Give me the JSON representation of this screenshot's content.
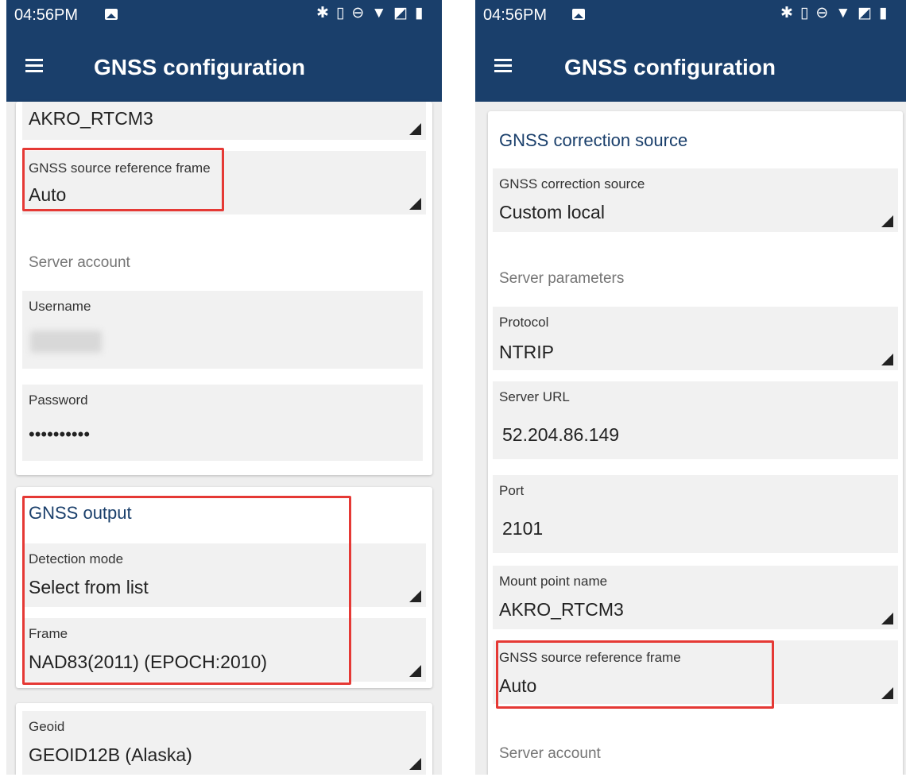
{
  "status_bar": {
    "time": "04:56PM",
    "icons": [
      "image-icon",
      "bluetooth-icon",
      "vibrate-icon",
      "do-not-disturb-icon",
      "wifi-icon",
      "no-sim-icon",
      "battery-icon"
    ]
  },
  "app_bar": {
    "title": "GNSS configuration"
  },
  "left_screen": {
    "mount_point_value": "AKRO_RTCM3",
    "reference_frame": {
      "label": "GNSS source reference frame",
      "value": "Auto"
    },
    "server_account": {
      "label": "Server account",
      "username_label": "Username",
      "password_label": "Password",
      "password_value": "••••••••••"
    },
    "gnss_output": {
      "title": "GNSS output",
      "detection_mode": {
        "label": "Detection mode",
        "value": "Select from list"
      },
      "frame": {
        "label": "Frame",
        "value": "NAD83(2011) (EPOCH:2010)"
      }
    },
    "geoid": {
      "label": "Geoid",
      "value": "GEOID12B (Alaska)"
    }
  },
  "right_screen": {
    "section_title": "GNSS correction source",
    "correction_source": {
      "label": "GNSS correction source",
      "value": "Custom local"
    },
    "server_parameters_label": "Server parameters",
    "protocol": {
      "label": "Protocol",
      "value": "NTRIP"
    },
    "server_url": {
      "label": "Server URL",
      "value": "52.204.86.149"
    },
    "port": {
      "label": "Port",
      "value": "2101"
    },
    "mount_point": {
      "label": "Mount point name",
      "value": "AKRO_RTCM3"
    },
    "reference_frame": {
      "label": "GNSS source reference frame",
      "value": "Auto"
    },
    "server_account_label": "Server account"
  },
  "colors": {
    "app_bar": "#1a3f6b",
    "section_title": "#1a3f6b",
    "highlight": "#e53935",
    "field_background": "#f1f1f1"
  }
}
